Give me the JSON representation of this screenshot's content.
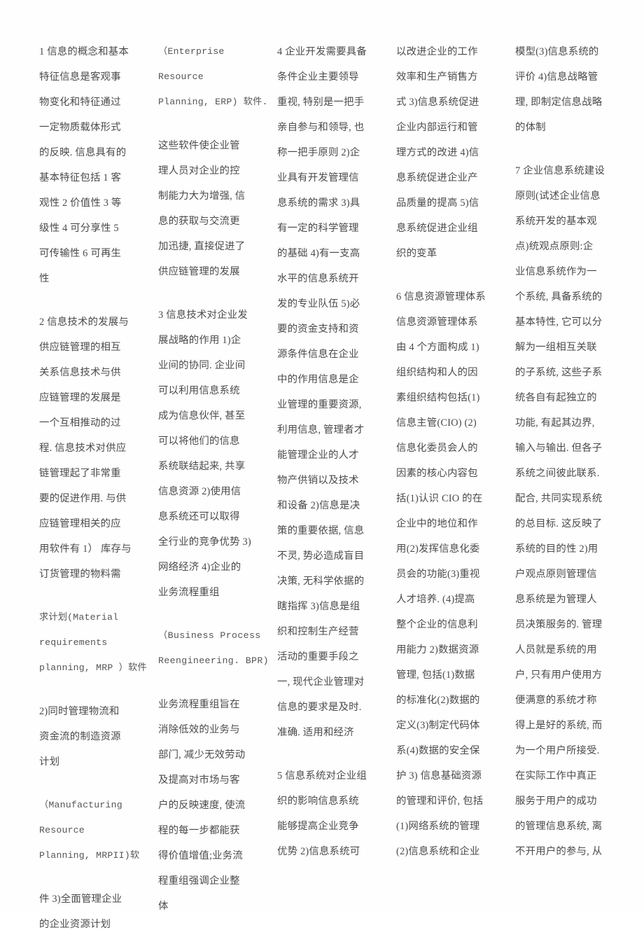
{
  "document": {
    "kind": "scanned-study-notes",
    "language": "zh-CN",
    "page_background": "#fefefe",
    "text_color": "#4b4b4b",
    "columns_count": 5
  },
  "columns": [
    {
      "index": 1,
      "paragraphs": [
        {
          "id": "p1",
          "style": "cjk",
          "lines": [
            "1 信息的概念和基本",
            "特征信息是客观事",
            "物变化和特征通过",
            "一定物质载体形式",
            "的反映. 信息具有的",
            "基本特征包括 1 客",
            "观性 2 价值性 3 等",
            "级性 4 可分享性 5",
            "可传输性 6 可再生",
            "性"
          ]
        },
        {
          "id": "p2",
          "style": "cjk",
          "lines": [
            "2 信息技术的发展与",
            "供应链管理的相互",
            "关系信息技术与供",
            "应链管理的发展是",
            "一个互相推动的过",
            "程. 信息技术对供应",
            "链管理起了非常重",
            "要的促进作用. 与供",
            "应链管理相关的应",
            "用软件有 1） 库存与",
            "订货管理的物料需"
          ]
        },
        {
          "id": "p3",
          "style": "mixed",
          "lines": [
            "求计划(Material",
            "requirements",
            "planning, MRP ）软件"
          ]
        },
        {
          "id": "p4",
          "style": "cjk",
          "lines": [
            "2)同时管理物流和",
            "资金流的制造资源",
            "计划"
          ]
        },
        {
          "id": "p5",
          "style": "mixed",
          "lines": [
            "（Manufacturing",
            "Resource",
            "Planning, MRPII)软"
          ]
        },
        {
          "id": "p6",
          "style": "cjk",
          "lines": [
            "件 3)全面管理企业",
            "的企业资源计划"
          ]
        }
      ]
    },
    {
      "index": 2,
      "paragraphs": [
        {
          "id": "p7",
          "style": "mixed",
          "lines": [
            "（Enterprise",
            "Resource",
            "Planning, ERP) 软件."
          ]
        },
        {
          "id": "p8",
          "style": "cjk",
          "lines": [
            "这些软件使企业管",
            "理人员对企业的控",
            "制能力大为增强, 信",
            "息的获取与交流更",
            "加迅捷, 直接促进了",
            "供应链管理的发展"
          ]
        },
        {
          "id": "p9",
          "style": "cjk",
          "lines": [
            "3 信息技术对企业发",
            "展战略的作用 1)企",
            "业间的协同. 企业间",
            "可以利用信息系统",
            "成为信息伙伴, 甚至",
            "可以将他们的信息",
            "系统联结起来, 共享",
            "信息资源 2)使用信",
            "息系统还可以取得",
            "全行业的竞争优势 3)",
            "网络经济 4)企业的",
            "业务流程重组"
          ]
        },
        {
          "id": "p10",
          "style": "mono",
          "lines": [
            "（Business Process",
            "Reengineering. BPR)"
          ]
        },
        {
          "id": "p11",
          "style": "cjk",
          "lines": [
            "业务流程重组旨在",
            "消除低效的业务与",
            "部门, 减少无效劳动",
            "及提高对市场与客",
            "户的反映速度, 使流",
            "程的每一步都能获",
            "得价值增值;业务流",
            "程重组强调企业整",
            "体"
          ]
        }
      ]
    },
    {
      "index": 3,
      "paragraphs": [
        {
          "id": "p12",
          "style": "cjk",
          "lines": [
            "4 企业开发需要具备",
            "条件企业主要领导",
            "重视, 特别是一把手",
            "亲自参与和领导, 也",
            "称一把手原则 2)企",
            "业具有开发管理信",
            "息系统的需求 3)具",
            "有一定的科学管理",
            "的基础 4)有一支高",
            "水平的信息系统开",
            "发的专业队伍 5)必",
            "要的资金支持和资",
            "源条件信息在企业",
            "中的作用信息是企",
            "业管理的重要资源,",
            "利用信息, 管理者才",
            "能管理企业的人才",
            "物产供销以及技术",
            "和设备 2)信息是决",
            "策的重要依据, 信息",
            "不灵, 势必造成盲目",
            "决策, 无科学依据的",
            "瞎指挥 3)信息是组",
            "织和控制生产经营",
            "活动的重要手段之",
            "一, 现代企业管理对",
            "信息的要求是及时.",
            "准确. 适用和经济"
          ]
        },
        {
          "id": "p13",
          "style": "cjk",
          "lines": [
            "5 信息系统对企业组",
            "织的影响信息系统",
            "能够提高企业竞争",
            "优势 2)信息系统可"
          ]
        }
      ]
    },
    {
      "index": 4,
      "paragraphs": [
        {
          "id": "p14",
          "style": "cjk",
          "lines": [
            "以改进企业的工作",
            "效率和生产销售方",
            "式 3)信息系统促进",
            "企业内部运行和管",
            "理方式的改进 4)信",
            "息系统促进企业产",
            "品质量的提高 5)信",
            "息系统促进企业组",
            "织的变革"
          ]
        },
        {
          "id": "p15",
          "style": "cjk",
          "lines": [
            "6 信息资源管理体系",
            "信息资源管理体系",
            "由 4 个方面构成 1)",
            "组织结构和人的因",
            "素组织结构包括(1)",
            "信息主管(CIO) (2)",
            "信息化委员会人的",
            "因素的核心内容包",
            "括(1)认识 CIO 的在",
            "企业中的地位和作",
            "用(2)发挥信息化委",
            "员会的功能(3)重视",
            "人才培养. (4)提高",
            "整个企业的信息利",
            "用能力 2)数据资源",
            "管理, 包括(1)数据",
            "的标准化(2)数据的",
            "定义(3)制定代码体",
            "系(4)数据的安全保",
            "护 3) 信息基础资源",
            "的管理和评价, 包括",
            "(1)网络系统的管理",
            "(2)信息系统和企业"
          ]
        }
      ]
    },
    {
      "index": 5,
      "paragraphs": [
        {
          "id": "p16",
          "style": "cjk",
          "lines": [
            "模型(3)信息系统的",
            "评价 4)信息战略管",
            "理, 即制定信息战略",
            "的体制"
          ]
        },
        {
          "id": "p17",
          "style": "cjk",
          "lines": [
            "7 企业信息系统建设",
            "原则(试述企业信息",
            "系统开发的基本观",
            "点)统观点原则:企",
            "业信息系统作为一",
            "个系统, 具备系统的",
            "基本特性, 它可以分",
            "解为一组相互关联",
            "的子系统, 这些子系",
            "统各自有起独立的",
            "功能, 有起其边界,",
            "输入与输出. 但各子",
            "系统之间彼此联系.",
            "配合, 共同实现系统",
            "的总目标. 这反映了",
            "系统的目的性 2)用",
            "户观点原则管理信",
            "息系统是为管理人",
            "员决策服务的. 管理",
            "人员就是系统的用",
            "户, 只有用户使用方",
            "便满意的系统才称",
            "得上是好的系统, 而",
            "为一个用户所接受.",
            "在实际工作中真正",
            "服务于用户的成功",
            "的管理信息系统, 离",
            "不开用户的参与, 从"
          ]
        }
      ]
    }
  ]
}
